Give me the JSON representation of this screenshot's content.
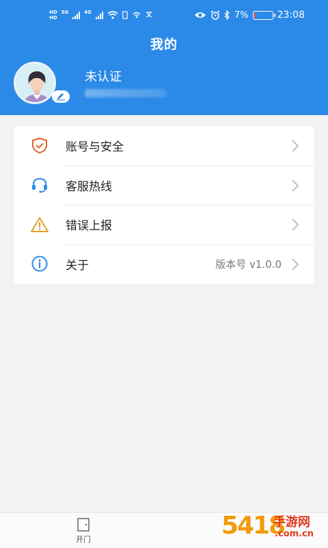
{
  "status_bar": {
    "hd1": "HD",
    "hd2": "HD",
    "net1": "5G",
    "net2": "4G",
    "battery_percent": "7%",
    "battery_level": 0.07,
    "time": "23:08"
  },
  "header": {
    "title": "我的"
  },
  "profile": {
    "name": "未认证"
  },
  "menu": {
    "items": [
      {
        "label": "账号与安全",
        "icon": "shield-check-icon",
        "value": ""
      },
      {
        "label": "客服热线",
        "icon": "headset-icon",
        "value": ""
      },
      {
        "label": "错误上报",
        "icon": "warning-icon",
        "value": ""
      },
      {
        "label": "关于",
        "icon": "info-icon",
        "value": "版本号 v1.0.0"
      }
    ]
  },
  "tabbar": {
    "tabs": [
      {
        "label": "开门",
        "icon": "door-icon"
      }
    ]
  },
  "watermark": {
    "number": "5418",
    "text": "手游网",
    "url": ".com.cn"
  },
  "colors": {
    "header_bg": "#2b8ae8",
    "shield": "#e3642b",
    "headset": "#2b8ae8",
    "warning": "#e0a12b",
    "info": "#2b8ae8"
  }
}
